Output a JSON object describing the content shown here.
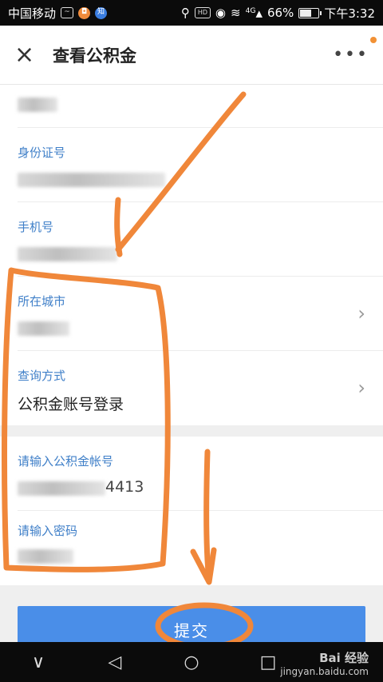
{
  "status_bar": {
    "carrier": "中国移动",
    "battery": "66%",
    "battery_level": 0.66,
    "time": "下午3:32",
    "hd": "HD",
    "network": "4G",
    "know_icon": "知"
  },
  "header": {
    "close_icon": "×",
    "title": "查看公积金",
    "more": "•••"
  },
  "form": {
    "id_label": "身份证号",
    "phone_label": "手机号",
    "city_label": "所在城市",
    "query_label": "查询方式",
    "query_value": "公积金账号登录",
    "account_label": "请输入公积金帐号",
    "account_value_tail": "4413",
    "password_label": "请输入密码"
  },
  "submit_label": "提交",
  "navbar": {
    "back": "◁",
    "home": "○",
    "recent": "□",
    "down": "∨"
  },
  "watermark": {
    "line1": "Bai 经验",
    "line2": "jingyan.baidu.com"
  },
  "colors": {
    "accent": "#4a8ee8",
    "label": "#3f7fc8",
    "annotation": "#f0873a"
  }
}
